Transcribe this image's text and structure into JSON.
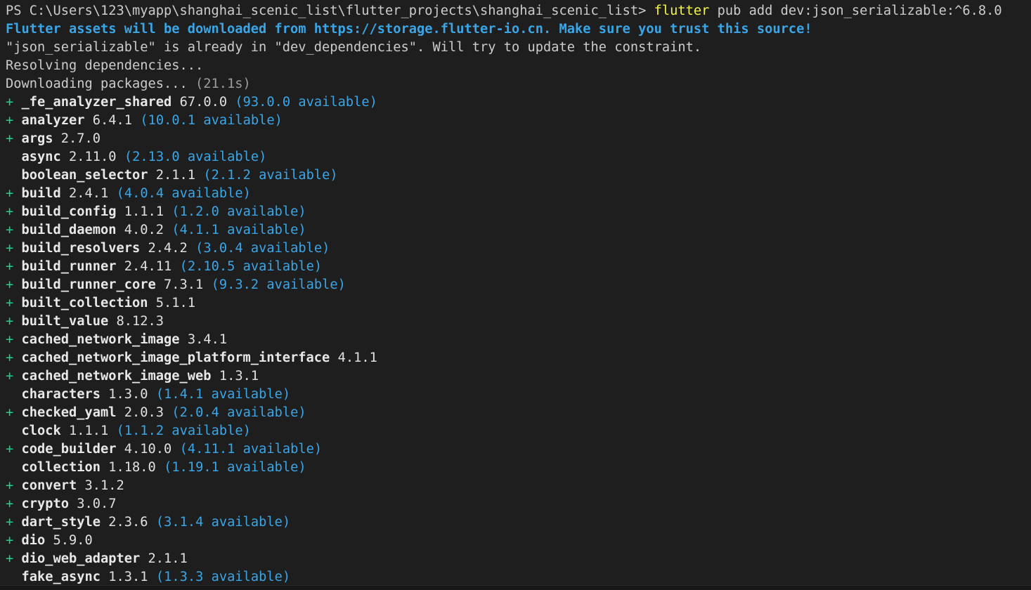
{
  "terminal": {
    "prompt": "PS C:\\Users\\123\\myapp\\shanghai_scenic_list\\flutter_projects\\shanghai_scenic_list> ",
    "command_bin": "flutter",
    "command_args": " pub add dev:json_serializable:^6.8.0",
    "notice": "Flutter assets will be downloaded from https://storage.flutter-io.cn. Make sure you trust this source!",
    "already_msg": "\"json_serializable\" is already in \"dev_dependencies\". Will try to update the constraint.",
    "resolving": "Resolving dependencies...",
    "downloading": "Downloading packages... ",
    "downloading_time": "(21.1s)"
  },
  "packages": [
    {
      "added": true,
      "name": "_fe_analyzer_shared",
      "version": "67.0.0",
      "available": "93.0.0"
    },
    {
      "added": true,
      "name": "analyzer",
      "version": "6.4.1",
      "available": "10.0.1"
    },
    {
      "added": true,
      "name": "args",
      "version": "2.7.0",
      "available": ""
    },
    {
      "added": false,
      "name": "async",
      "version": "2.11.0",
      "available": "2.13.0"
    },
    {
      "added": false,
      "name": "boolean_selector",
      "version": "2.1.1",
      "available": "2.1.2"
    },
    {
      "added": true,
      "name": "build",
      "version": "2.4.1",
      "available": "4.0.4"
    },
    {
      "added": true,
      "name": "build_config",
      "version": "1.1.1",
      "available": "1.2.0"
    },
    {
      "added": true,
      "name": "build_daemon",
      "version": "4.0.2",
      "available": "4.1.1"
    },
    {
      "added": true,
      "name": "build_resolvers",
      "version": "2.4.2",
      "available": "3.0.4"
    },
    {
      "added": true,
      "name": "build_runner",
      "version": "2.4.11",
      "available": "2.10.5"
    },
    {
      "added": true,
      "name": "build_runner_core",
      "version": "7.3.1",
      "available": "9.3.2"
    },
    {
      "added": true,
      "name": "built_collection",
      "version": "5.1.1",
      "available": ""
    },
    {
      "added": true,
      "name": "built_value",
      "version": "8.12.3",
      "available": ""
    },
    {
      "added": true,
      "name": "cached_network_image",
      "version": "3.4.1",
      "available": ""
    },
    {
      "added": true,
      "name": "cached_network_image_platform_interface",
      "version": "4.1.1",
      "available": ""
    },
    {
      "added": true,
      "name": "cached_network_image_web",
      "version": "1.3.1",
      "available": ""
    },
    {
      "added": false,
      "name": "characters",
      "version": "1.3.0",
      "available": "1.4.1"
    },
    {
      "added": true,
      "name": "checked_yaml",
      "version": "2.0.3",
      "available": "2.0.4"
    },
    {
      "added": false,
      "name": "clock",
      "version": "1.1.1",
      "available": "1.1.2"
    },
    {
      "added": true,
      "name": "code_builder",
      "version": "4.10.0",
      "available": "4.11.1"
    },
    {
      "added": false,
      "name": "collection",
      "version": "1.18.0",
      "available": "1.19.1"
    },
    {
      "added": true,
      "name": "convert",
      "version": "3.1.2",
      "available": ""
    },
    {
      "added": true,
      "name": "crypto",
      "version": "3.0.7",
      "available": ""
    },
    {
      "added": true,
      "name": "dart_style",
      "version": "2.3.6",
      "available": "3.1.4"
    },
    {
      "added": true,
      "name": "dio",
      "version": "5.9.0",
      "available": ""
    },
    {
      "added": true,
      "name": "dio_web_adapter",
      "version": "2.1.1",
      "available": ""
    },
    {
      "added": false,
      "name": "fake_async",
      "version": "1.3.1",
      "available": "1.3.3"
    }
  ],
  "colors": {
    "background": "#1e1e1e",
    "text": "#cccccc",
    "accent_blue": "#3aa6e8",
    "added_green": "#23d18b",
    "command_yellow": "#f5f543"
  }
}
